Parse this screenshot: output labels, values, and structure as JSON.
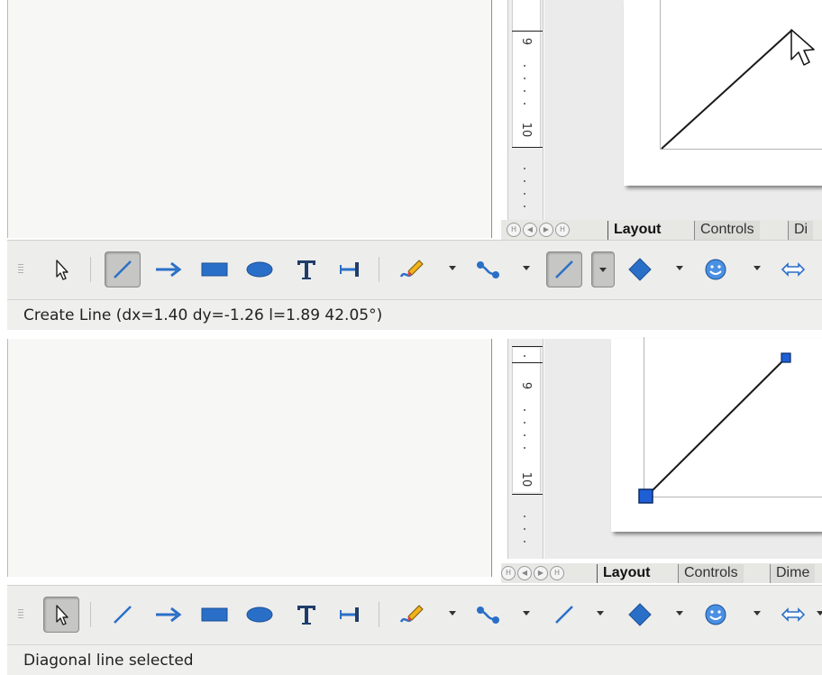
{
  "top_panel": {
    "ruler": {
      "label_upper": "9",
      "label_lower": "10"
    },
    "sheet_tabs": {
      "nav_first": "H",
      "nav_prev": "◀",
      "nav_next": "▶",
      "nav_last": "H",
      "tabs": [
        "Layout",
        "Controls",
        "Di"
      ]
    },
    "status_text": "Create Line (dx=1.40 dy=-1.26  l=1.89 42.05°)",
    "toolbar_pressed": [
      "line",
      "line-dropdown"
    ]
  },
  "bottom_panel": {
    "ruler": {
      "label_upper": "9",
      "label_lower": "10"
    },
    "sheet_tabs": {
      "nav_first": "H",
      "nav_prev": "◀",
      "nav_next": "▶",
      "nav_last": "H",
      "tabs": [
        "Layout",
        "Controls",
        "Dime"
      ]
    },
    "status_text": "Diagonal line selected",
    "toolbar_pressed": [
      "select"
    ]
  },
  "toolbar_icons": [
    "select-icon",
    "line-icon",
    "arrow-line-icon",
    "rectangle-icon",
    "ellipse-icon",
    "text-icon",
    "dimension-line-icon",
    "freeform-curve-icon",
    "connector-icon",
    "line-style-icon",
    "basic-shapes-icon",
    "symbol-shapes-icon",
    "block-arrows-icon"
  ],
  "colors": {
    "accent_blue": "#2a6fc7",
    "selection_handle": "#1f5fd6"
  }
}
